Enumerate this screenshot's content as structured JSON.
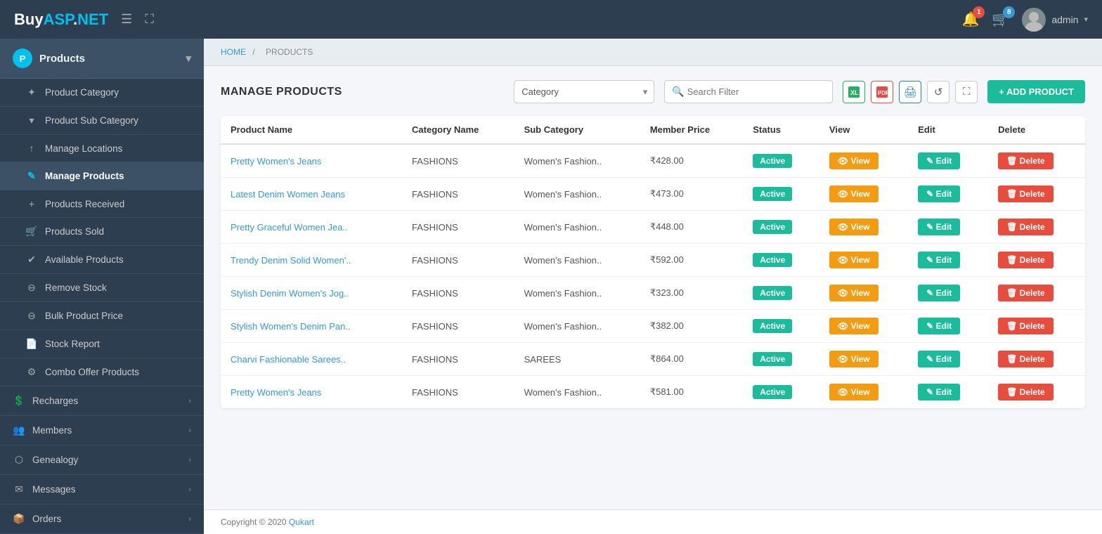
{
  "brand": {
    "buy": "Buy",
    "asp": "ASP",
    "dot": ".",
    "net": "NET"
  },
  "navbar": {
    "hamburger": "☰",
    "expand": "⛶",
    "notifications_count": "1",
    "cart_count": "8",
    "admin_label": "admin",
    "admin_chevron": "▾"
  },
  "sidebar": {
    "products_header": "Products",
    "items": [
      {
        "id": "product-category",
        "label": "Product Category",
        "icon": "✦",
        "active": false
      },
      {
        "id": "product-sub-category",
        "label": "Product Sub Category",
        "icon": "▾",
        "active": false
      },
      {
        "id": "manage-locations",
        "label": "Manage Locations",
        "icon": "↑",
        "active": false
      },
      {
        "id": "manage-products",
        "label": "Manage Products",
        "icon": "✎",
        "active": true
      },
      {
        "id": "products-received",
        "label": "Products Received",
        "icon": "+",
        "active": false
      },
      {
        "id": "products-sold",
        "label": "Products Sold",
        "icon": "🛒",
        "active": false
      },
      {
        "id": "available-products",
        "label": "Available Products",
        "icon": "✔",
        "active": false
      },
      {
        "id": "remove-stock",
        "label": "Remove Stock",
        "icon": "⊖",
        "active": false
      },
      {
        "id": "bulk-product-price",
        "label": "Bulk Product Price",
        "icon": "⊖",
        "active": false
      },
      {
        "id": "stock-report",
        "label": "Stock Report",
        "icon": "📄",
        "active": false
      },
      {
        "id": "combo-offer-products",
        "label": "Combo Offer Products",
        "icon": "⚙",
        "active": false
      }
    ],
    "parents": [
      {
        "id": "recharges",
        "label": "Recharges",
        "icon": "💲"
      },
      {
        "id": "members",
        "label": "Members",
        "icon": "👥"
      },
      {
        "id": "genealogy",
        "label": "Genealogy",
        "icon": "⬢"
      },
      {
        "id": "messages",
        "label": "Messages",
        "icon": "✉"
      },
      {
        "id": "orders",
        "label": "Orders",
        "icon": "📦"
      }
    ]
  },
  "breadcrumb": {
    "home": "HOME",
    "separator": "/",
    "current": "PRODUCTS"
  },
  "manage_products": {
    "title": "MANAGE PRODUCTS",
    "category_placeholder": "Category",
    "search_placeholder": "Search Filter",
    "add_product_label": "+ ADD PRODUCT",
    "table": {
      "columns": [
        "Product Name",
        "Category Name",
        "Sub Category",
        "Member Price",
        "Status",
        "View",
        "Edit",
        "Delete"
      ],
      "rows": [
        {
          "name": "Pretty Women's Jeans",
          "category": "FASHIONS",
          "sub_category": "Women's Fashion..",
          "price": "₹428.00",
          "status": "Active"
        },
        {
          "name": "Latest Denim Women Jeans",
          "category": "FASHIONS",
          "sub_category": "Women's Fashion..",
          "price": "₹473.00",
          "status": "Active"
        },
        {
          "name": "Pretty Graceful Women Jea..",
          "category": "FASHIONS",
          "sub_category": "Women's Fashion..",
          "price": "₹448.00",
          "status": "Active"
        },
        {
          "name": "Trendy Denim Solid Women'..",
          "category": "FASHIONS",
          "sub_category": "Women's Fashion..",
          "price": "₹592.00",
          "status": "Active"
        },
        {
          "name": "Stylish Denim Women's Jog..",
          "category": "FASHIONS",
          "sub_category": "Women's Fashion..",
          "price": "₹323.00",
          "status": "Active"
        },
        {
          "name": "Stylish Women's Denim Pan..",
          "category": "FASHIONS",
          "sub_category": "Women's Fashion..",
          "price": "₹382.00",
          "status": "Active"
        },
        {
          "name": "Charvi Fashionable Sarees..",
          "category": "FASHIONS",
          "sub_category": "SAREES",
          "price": "₹864.00",
          "status": "Active"
        },
        {
          "name": "Pretty Women's Jeans",
          "category": "FASHIONS",
          "sub_category": "Women's Fashion..",
          "price": "₹581.00",
          "status": "Active"
        }
      ],
      "btn_view": "View",
      "btn_edit": "Edit",
      "btn_delete": "Delete"
    }
  },
  "footer": {
    "copyright": "Copyright © 2020 ",
    "brand_link": "Qukart"
  }
}
